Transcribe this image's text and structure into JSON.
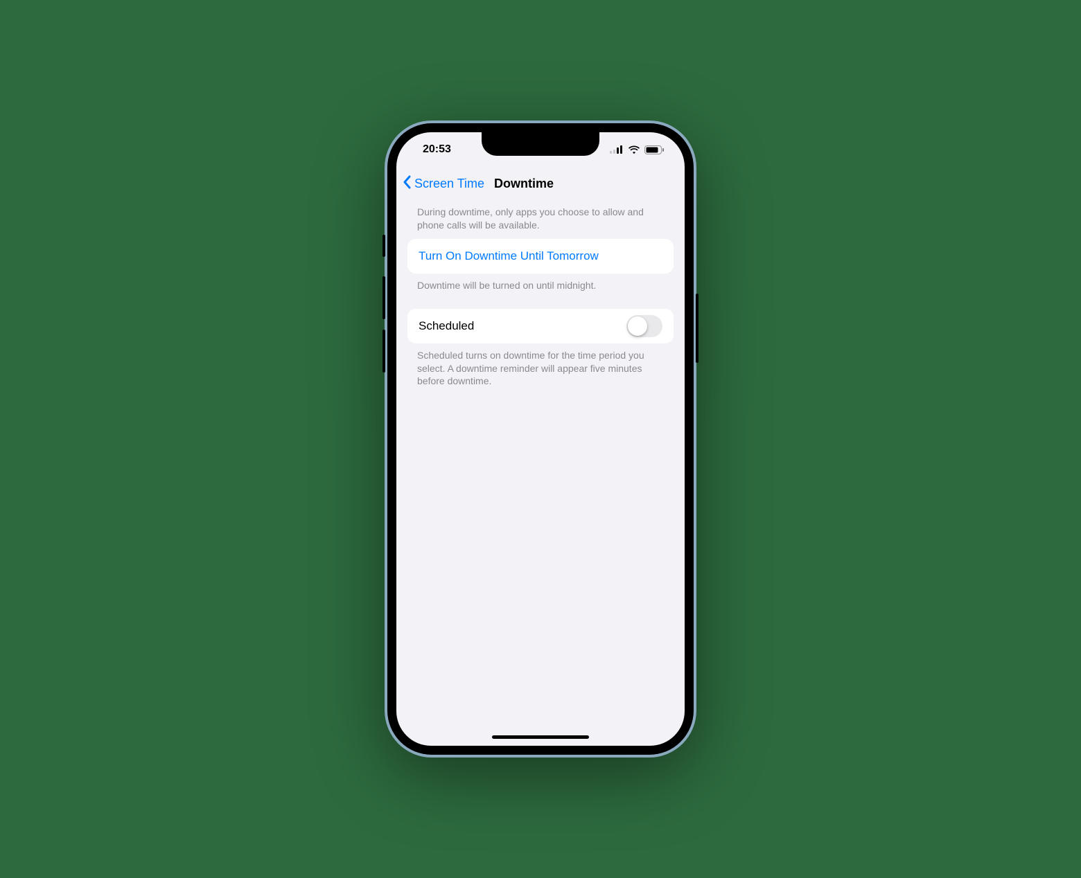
{
  "status": {
    "time": "20:53"
  },
  "nav": {
    "back_label": "Screen Time",
    "title": "Downtime"
  },
  "intro_text": "During downtime, only apps you choose to allow and phone calls will be available.",
  "turn_on": {
    "label": "Turn On Downtime Until Tomorrow",
    "footer": "Downtime will be turned on until midnight."
  },
  "scheduled": {
    "label": "Scheduled",
    "footer": "Scheduled turns on downtime for the time period you select. A downtime reminder will appear five minutes before downtime."
  }
}
